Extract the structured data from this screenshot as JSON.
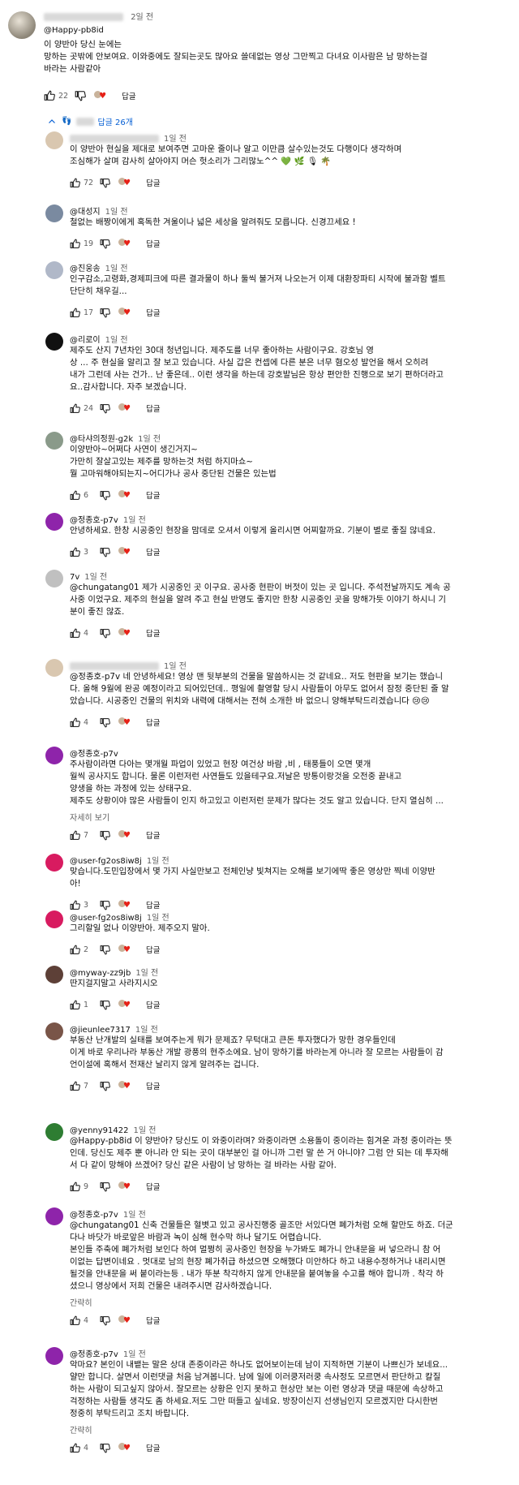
{
  "top_comment": {
    "handle": "@Happy-pb8id",
    "time": "2일 전",
    "body": "이 양반아 당신 눈에는\n망하는 곳밖에 안보여요. 이와중에도 잘되는곳도 많아요 쓸데없는 영상 그만찍고 다녀요 이사람은 남 망하는걸\n바라는 사람같아",
    "likes": "22",
    "reply_label": "답글"
  },
  "replies_toggle": {
    "label": "답글 26개"
  },
  "replies": [
    {
      "handle": "",
      "time": "1일 전",
      "avatar_color": "#d9c7b0",
      "body": "이 양반아 현실을 제대로 보여주면 고마운 줄이나 알고 이만큼 살수있는것도 다행이다 생각하며\n조심해가 살며 감사히 살아야지 머슨 헛소리가 그리많노^^ 💚 🌿 🎙 🌴",
      "likes": "72",
      "more": ""
    },
    {
      "handle": "@대성지",
      "time": "1일 전",
      "avatar_color": "#7a8aa0",
      "body": "철없는 배짱이에게 혹독한 겨울이나 넓은 세상을 알려줘도 모릅니다. 신경끄세요 !",
      "likes": "19",
      "more": ""
    },
    {
      "handle": "@진웅송",
      "time": "1일 전",
      "avatar_color": "#b0b8c8",
      "body": "인구감소,고령화,경제피크에 따른 결과물이 하나 둘씩 불거져 나오는거 이제 대환장파티 시작에 불과함 벨트\n단단히 채우길...",
      "likes": "17",
      "more": ""
    },
    {
      "handle": "@리로이",
      "time": "1일 전",
      "avatar_color": "#111111",
      "body": "제주도 산지 7년차인 30대 청년입니다. 제주도를 너무 좋아하는 사람이구요. 강호님 영\n상 ... 주 현실을 알리고 잘 보고 있습니다. 사실 갑은 컨셉에 다른 분은 너무 혐오성 발언을 해서 오히려\n내가 그런데 사는 건가.. 난 좋은데.. 이런 생각을 하는데 강호발님은 항상 편안한 진행으로 보기 편하더라고\n요..감사합니다. 자주 보겠습니다.",
      "likes": "24",
      "more": ""
    },
    {
      "handle": "@타샤의정원-g2k",
      "time": "1일 전",
      "avatar_color": "#8a9a8a",
      "body": "이양반아~어쩌다 사연이 생긴거지~\n가만히 잘살고있는 제주를 망하는것 처럼 하지마쇼~\n뭘 고마워해야되는지~어디가나 공사 중단된 건물은 있는법",
      "likes": "6",
      "more": ""
    },
    {
      "handle": "@정종호-p7v",
      "time": "1일 전",
      "avatar_color": "#8e24aa",
      "body": "안녕하세요. 한창 시공중인 현장을 맘데로 오셔서 이렇게 올리시면 어찌할까요. 기분이 별로 좋질 않네요.",
      "likes": "3",
      "more": ""
    },
    {
      "handle": "7v",
      "time": "1일 전",
      "avatar_color": "#c0c0c0",
      "body": "@chungatang01 제가 시공중인 곳 이구요. 공사중 현판이 버젓이 있는 곳 입니다. 주석전날까지도 계속 공\n사중 이었구요. 제주의 현실을 알려 주고 현실 반영도 좋지만 한창 시공중인 곳을 망해가듯 이야기 하시니 기\n분이 좋진 않죠.",
      "likes": "4",
      "more": ""
    },
    {
      "handle": "",
      "time": "1일 전",
      "avatar_color": "#d9c7b0",
      "body": "@정종호-p7v 네 안녕하세요! 영상 맨 뒷부분의 건물을 말씀하시는 것 같네요.. 저도 현판을 보기는 했습니\n다. 올해 9월에 완공 예정이라고 되어있던데.. 평일에 촬영할 당시 사람들이 아무도 없어서 잠정 중단된 줄 알\n았습니다. 시공중인 건물의 위치와 내력에 대해서는 전혀 소개한 바 없으니 양해부탁드리겠습니다 😢😢",
      "likes": "4",
      "more": ""
    },
    {
      "handle": "@정종호-p7v",
      "time": "",
      "avatar_color": "#8e24aa",
      "body": "주사람이라면 다아는 몇개월 파업이 있었고 현장 여건상 바람 ,비 , 태풍들이 오면 몇개\n월씩 공사지도 합니다. 물론 이런저런 사연들도 있을테구요.저날은 방통이랑것을 오전중 끝내고\n양생을 하는 과정에 있는 상태구요.\n제주도 상황이야 많은 사람들이 인지 하고있고 이런저런 문제가 많다는 것도 알고 있습니다. 단지 열심히 ...",
      "likes": "7",
      "more": "자세히 보기"
    },
    {
      "handle": "@user-fg2os8iw8j",
      "time": "1일 전",
      "avatar_color": "#d81b60",
      "body": "맞습니다.도민입장에서 몇 가지 사실만보고 전체인냥 빛쳐지는 오해를 보기에딱 좋은 영상만 찍네 이양반\n아!",
      "likes": "3",
      "more": ""
    },
    {
      "handle": "@user-fg2os8iw8j",
      "time": "1일 전",
      "avatar_color": "#d81b60",
      "body": "그리할일 없나 이양반아. 제주오지 말아.",
      "likes": "2",
      "more": ""
    },
    {
      "handle": "@myway-zz9jb",
      "time": "1일 전",
      "avatar_color": "#5d4037",
      "body": "딴지걸지말고 사라지시오",
      "likes": "1",
      "more": ""
    },
    {
      "handle": "@jieunlee7317",
      "time": "1일 전",
      "avatar_color": "#795548",
      "body": "부동산 난개발의 실태를 보여주는게 뭐가 문제죠? 무턱대고 큰돈 투자했다가 망한 경우들인데\n이게 바로 우리나라 부동산 개발 광풍의 현주소에요. 남이 망하기를 바라는게 아니라 잘 모르는 사람들이 감\n언이설에 혹해서 전재산 날리지 않게 알려주는 겁니다.",
      "likes": "7",
      "more": ""
    },
    {
      "handle": "@yenny91422",
      "time": "1일 전",
      "avatar_color": "#2e7d32",
      "body": "@Happy-pb8id 이 양반아? 당신도 이 와중이라며? 와중이라면 소용돌이 중이라는 힘겨운 과정 중이라는 뜻\n인데. 당신도 제주 뿐 아니라 안 되는 곳이 대부분인 걸 아니까 그런 말 쓴 거 아니야? 그럼 안 되는 데 투자해\n서 다 같이 망해야 쓰겠어? 당신 같은 사람이 남 망하는 걸 바라는 사람 같아.",
      "likes": "9",
      "more": ""
    },
    {
      "handle": "@정종호-p7v",
      "time": "1일 전",
      "avatar_color": "#8e24aa",
      "body": "@chungatang01 신축 건물들은 혈볏고 있고 공사진행중 골조만 서있다면 폐가처럼 오해 할만도 하죠. 더군\n다나 바닷가 바로앞은 바람과 녹이 심해 현수막 하나 달기도 어렵습니다.\n본인들 주축에 폐가처럼 보인다 하여 멀쩡히 공사중인 현장을 누가봐도 폐가니 안내문을 써 넣으라니 참 어\n이없는 답변이네요 . 멋대로 남의 현장 폐가취급 하셨으면 오해했다 미안하다 하고 내용수정하거나 내리시면\n될것을 안내문을 써 붙이라는등 . 내가 뚜분 착각하지 않게 안내문을 붙여놓을 수고를 해야 합니까 . 착각 하\n셨으니 영상에서 저희 건물은 내려주시면 감사하겠습니다.",
      "likes": "4",
      "more": "간략히"
    },
    {
      "handle": "@정종호-p7v",
      "time": "1일 전",
      "avatar_color": "#8e24aa",
      "body": "악마요? 본인이 내뱉는 말은 상대 존중이라곤 하나도 없어보이는데 남이 지적하면 기분이 나쁘신가 보네요...\n얄만 합니다. 살면서 이런댓글 처음 남겨봅니다. 남에 일에 이러쿵저러쿵 속사정도 모르면서 판단하고 칼질\n하는 사람이 되고싶지 않아서. 잘모르는 상황은 인지 못하고 현상만 보는 이런 영상과 댓글 때문에 속상하고\n걱정하는 사람들 생각도 좀 하세요.저도 그만 떠들고 싶네요. 방장이신지 선생님인지 모르겠지만 다시한번\n정중히 부탁드리고 조치 바랍니다.",
      "likes": "4",
      "more": "간략히"
    }
  ],
  "labels": {
    "reply": "답글"
  }
}
